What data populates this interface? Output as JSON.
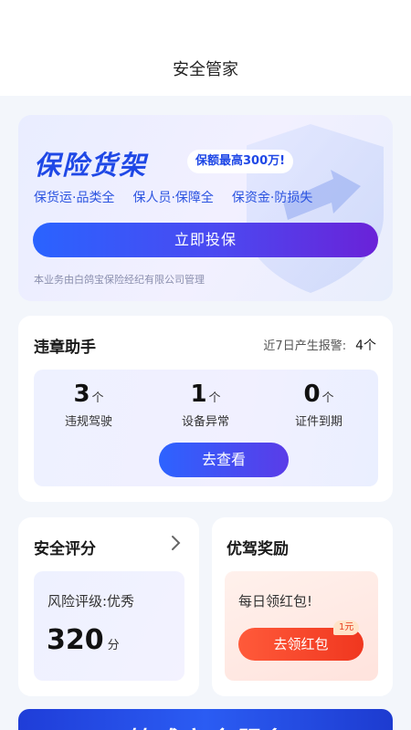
{
  "header": {
    "title": "安全管家"
  },
  "insurance": {
    "title": "保险货架",
    "tag": "保额最高300万!",
    "features": [
      "保货运·品类全",
      "保人员·保障全",
      "保资金·防损失"
    ],
    "button": "立即投保",
    "note": "本业务由白鸽宝保险经纪有限公司管理",
    "icon": "shield-icon"
  },
  "violations": {
    "title": "违章助手",
    "alert_label": "近7日产生报警:",
    "alert_count": "4个",
    "stats": [
      {
        "value": "3",
        "unit": "个",
        "label": "违规驾驶"
      },
      {
        "value": "1",
        "unit": "个",
        "label": "设备异常"
      },
      {
        "value": "0",
        "unit": "个",
        "label": "证件到期"
      }
    ],
    "button": "去查看"
  },
  "score": {
    "title": "安全评分",
    "risk": "风险评级:优秀",
    "value": "320",
    "unit": "分",
    "arrow_icon": "chevron-right-icon"
  },
  "reward": {
    "title": "优驾奖励",
    "daily": "每日领红包!",
    "button": "去领红包",
    "tag": "1元"
  },
  "banner": {
    "text": "赫威安全服务"
  },
  "colors": {
    "brand_blue": "#1f48e6",
    "accent_red": "#f0371f",
    "background": "#f3f6fb"
  }
}
